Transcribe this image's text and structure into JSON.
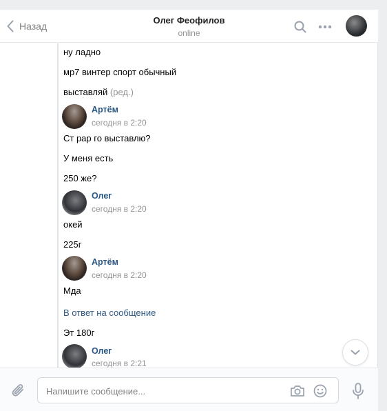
{
  "header": {
    "back_label": "Назад",
    "title": "Олег Феофилов",
    "status": "online"
  },
  "messages": [
    {
      "type": "text",
      "text": "ну ладно"
    },
    {
      "type": "text",
      "text": "мр7 винтер спорт обычный"
    },
    {
      "type": "text",
      "text": "выставляй",
      "edited": "(ред.)"
    },
    {
      "type": "author",
      "name": "Артём",
      "time": "сегодня в 2:20"
    },
    {
      "type": "text",
      "text": "Ст рар го выставлю?"
    },
    {
      "type": "text",
      "text": "У меня есть"
    },
    {
      "type": "text",
      "text": "250 же?"
    },
    {
      "type": "author",
      "name": "Олег",
      "time": "сегодня в 2:20"
    },
    {
      "type": "text",
      "text": "окей"
    },
    {
      "type": "text",
      "text": "225г"
    },
    {
      "type": "author",
      "name": "Артём",
      "time": "сегодня в 2:20"
    },
    {
      "type": "text",
      "text": "Мда"
    },
    {
      "type": "reply",
      "text": "В ответ на сообщение"
    },
    {
      "type": "text",
      "text": "Эт 180г"
    },
    {
      "type": "author",
      "name": "Олег",
      "time": "сегодня в 2:21"
    }
  ],
  "composer": {
    "placeholder": "Напишите сообщение..."
  },
  "colors": {
    "link": "#2a5885",
    "muted": "#939393",
    "icon": "#99a2ad"
  }
}
